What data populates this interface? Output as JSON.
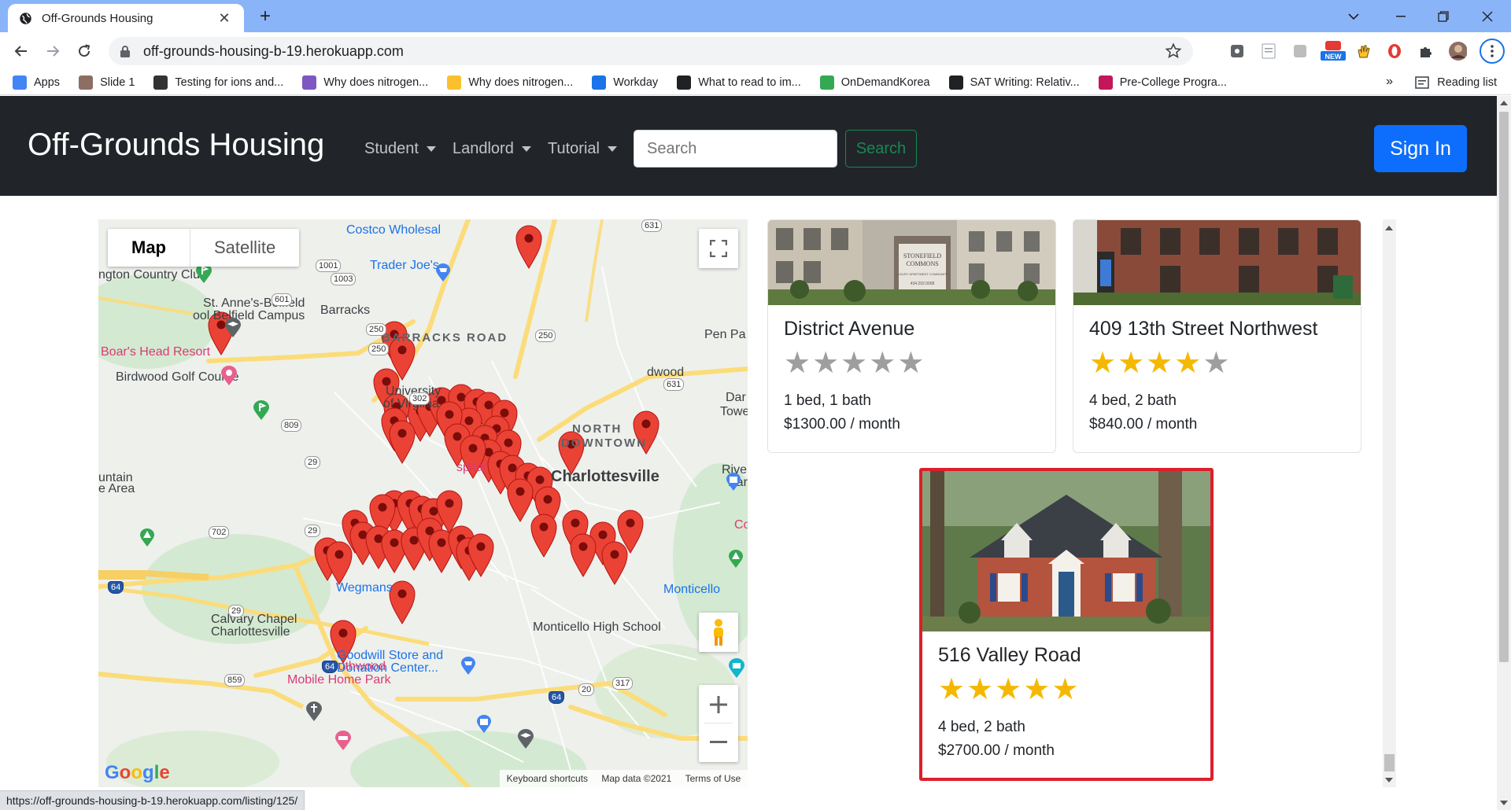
{
  "browser": {
    "tab_title": "Off-Grounds Housing",
    "url": "off-grounds-housing-b-19.herokuapp.com",
    "bookmarks": [
      {
        "label": "Apps",
        "color": "#4285f4"
      },
      {
        "label": "Slide 1",
        "color": "#8d6e63"
      },
      {
        "label": "Testing for ions and...",
        "color": "#333333"
      },
      {
        "label": "Why does nitrogen...",
        "color": "#7e57c2"
      },
      {
        "label": "Why does nitrogen...",
        "color": "#fbc02d"
      },
      {
        "label": "Workday",
        "color": "#1a73e8"
      },
      {
        "label": "What to read to im...",
        "color": "#202124"
      },
      {
        "label": "OnDemandKorea",
        "color": "#34a853"
      },
      {
        "label": "SAT Writing: Relativ...",
        "color": "#202124"
      },
      {
        "label": "Pre-College Progra...",
        "color": "#c2185b"
      }
    ],
    "more_bookmarks": "»",
    "reading_list": "Reading list",
    "ext_new_badge": "NEW",
    "status_url": "https://off-grounds-housing-b-19.herokuapp.com/listing/125/"
  },
  "nav": {
    "brand": "Off-Grounds Housing",
    "links": [
      "Student",
      "Landlord",
      "Tutorial"
    ],
    "search_placeholder": "Search",
    "search_button": "Search",
    "signin": "Sign In"
  },
  "map": {
    "type_map": "Map",
    "type_satellite": "Satellite",
    "labels": [
      {
        "text": "Costco Wholesal",
        "cls": "blue"
      },
      {
        "text": "Trader Joe's",
        "cls": "blue"
      },
      {
        "text": "ngton Country Club",
        "cls": "dark"
      },
      {
        "text": "St. Anne's-Belfield",
        "cls": "dark"
      },
      {
        "text": "ool Belfield Campus",
        "cls": "dark"
      },
      {
        "text": "Barracks",
        "cls": "dark"
      },
      {
        "text": "BARRACKS ROAD",
        "cls": "bold"
      },
      {
        "text": "Boar's Head Resort",
        "cls": "pink"
      },
      {
        "text": "Birdwood Golf Course",
        "cls": "dark"
      },
      {
        "text": "University",
        "cls": "dark"
      },
      {
        "text": "of Virginia",
        "cls": "dark"
      },
      {
        "text": "Pen Pa",
        "cls": "dark"
      },
      {
        "text": "dwood",
        "cls": "dark"
      },
      {
        "text": "NORTH",
        "cls": "bold"
      },
      {
        "text": "DOWNTOWN",
        "cls": "bold"
      },
      {
        "text": "Charlottesville",
        "cls": "dark"
      },
      {
        "text": "Dar",
        "cls": "dark"
      },
      {
        "text": "Towe",
        "cls": "dark"
      },
      {
        "text": "Riverview",
        "cls": "dark"
      },
      {
        "text": "Park",
        "cls": "dark"
      },
      {
        "text": "untain",
        "cls": "dark"
      },
      {
        "text": "e Area",
        "cls": "dark"
      },
      {
        "text": "Wegmans",
        "cls": "blue"
      },
      {
        "text": "Monticello",
        "cls": "blue"
      },
      {
        "text": "Monticello High School",
        "cls": "dark"
      },
      {
        "text": "Calvary Chapel",
        "cls": "dark"
      },
      {
        "text": "Charlottesville",
        "cls": "dark"
      },
      {
        "text": "Goodwill Store and",
        "cls": "blue"
      },
      {
        "text": "Donation Center...",
        "cls": "blue"
      },
      {
        "text": "Southwood",
        "cls": "pink"
      },
      {
        "text": "Mobile Home Park",
        "cls": "pink"
      },
      {
        "text": "Co",
        "cls": "pink"
      },
      {
        "text": "spital",
        "cls": "pink"
      }
    ],
    "shields": [
      "631",
      "1001",
      "1003",
      "601",
      "250",
      "250",
      "250",
      "302",
      "631",
      "809",
      "29",
      "29",
      "702",
      "64",
      "29",
      "859",
      "64",
      "64",
      "20",
      "317"
    ],
    "google": "Google",
    "footer": [
      "Keyboard shortcuts",
      "Map data ©2021",
      "Terms of Use"
    ]
  },
  "listings": [
    {
      "title": "District Avenue",
      "rating": 0,
      "beds": "1 bed, 1 bath",
      "price": "$1300.00 / month",
      "highlight": false
    },
    {
      "title": "409 13th Street Northwest",
      "rating": 4,
      "beds": "4 bed, 2 bath",
      "price": "$840.00 / month",
      "highlight": false
    },
    {
      "title": "516 Valley Road",
      "rating": 5,
      "beds": "4 bed, 2 bath",
      "price": "$2700.00 / month",
      "highlight": true
    }
  ],
  "photo_text": {
    "stonefield_1": "STONEFIELD",
    "stonefield_2": "COMMONS",
    "stonefield_3": "LUXURY APARTMENT COMMUNITY",
    "stonefield_4": "434.202.0008"
  },
  "colors": {
    "accent": "#0d6efd",
    "nav_bg": "#212529",
    "success": "#198754",
    "highlight": "#dc1f2a",
    "star": "#f5b800"
  }
}
